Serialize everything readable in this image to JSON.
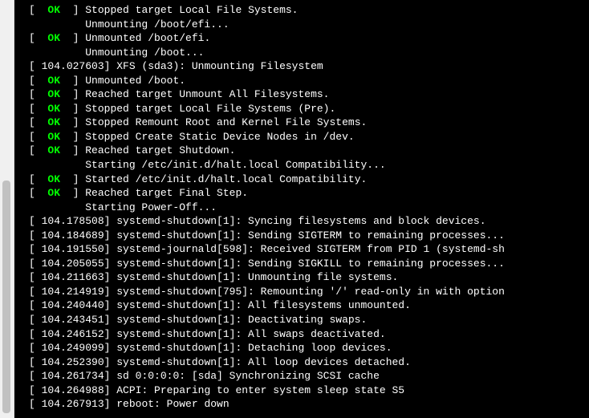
{
  "lines": [
    {
      "type": "ok",
      "text": "Stopped target Local File Systems."
    },
    {
      "type": "plain_indent",
      "text": "Unmounting /boot/efi..."
    },
    {
      "type": "ok",
      "text": "Unmounted /boot/efi."
    },
    {
      "type": "plain_indent",
      "text": "Unmounting /boot..."
    },
    {
      "type": "ts",
      "ts": "104.027603",
      "text": "XFS (sda3): Unmounting Filesystem"
    },
    {
      "type": "ok",
      "text": "Unmounted /boot."
    },
    {
      "type": "ok",
      "text": "Reached target Unmount All Filesystems."
    },
    {
      "type": "ok",
      "text": "Stopped target Local File Systems (Pre)."
    },
    {
      "type": "ok",
      "text": "Stopped Remount Root and Kernel File Systems."
    },
    {
      "type": "ok",
      "text": "Stopped Create Static Device Nodes in /dev."
    },
    {
      "type": "ok",
      "text": "Reached target Shutdown."
    },
    {
      "type": "plain_indent",
      "text": "Starting /etc/init.d/halt.local Compatibility..."
    },
    {
      "type": "ok",
      "text": "Started /etc/init.d/halt.local Compatibility."
    },
    {
      "type": "ok",
      "text": "Reached target Final Step."
    },
    {
      "type": "plain_indent",
      "text": "Starting Power-Off..."
    },
    {
      "type": "ts",
      "ts": "104.178508",
      "text": "systemd-shutdown[1]: Syncing filesystems and block devices."
    },
    {
      "type": "ts",
      "ts": "104.184689",
      "text": "systemd-shutdown[1]: Sending SIGTERM to remaining processes..."
    },
    {
      "type": "ts",
      "ts": "104.191550",
      "text": "systemd-journald[598]: Received SIGTERM from PID 1 (systemd-sh"
    },
    {
      "type": "ts",
      "ts": "104.205055",
      "text": "systemd-shutdown[1]: Sending SIGKILL to remaining processes..."
    },
    {
      "type": "ts",
      "ts": "104.211663",
      "text": "systemd-shutdown[1]: Unmounting file systems."
    },
    {
      "type": "ts",
      "ts": "104.214919",
      "text": "systemd-shutdown[795]: Remounting '/' read-only in with option"
    },
    {
      "type": "ts",
      "ts": "104.240440",
      "text": "systemd-shutdown[1]: All filesystems unmounted."
    },
    {
      "type": "ts",
      "ts": "104.243451",
      "text": "systemd-shutdown[1]: Deactivating swaps."
    },
    {
      "type": "ts",
      "ts": "104.246152",
      "text": "systemd-shutdown[1]: All swaps deactivated."
    },
    {
      "type": "ts",
      "ts": "104.249099",
      "text": "systemd-shutdown[1]: Detaching loop devices."
    },
    {
      "type": "ts",
      "ts": "104.252390",
      "text": "systemd-shutdown[1]: All loop devices detached."
    },
    {
      "type": "ts",
      "ts": "104.261734",
      "text": "sd 0:0:0:0: [sda] Synchronizing SCSI cache"
    },
    {
      "type": "ts",
      "ts": "104.264988",
      "text": "ACPI: Preparing to enter system sleep state S5"
    },
    {
      "type": "ts",
      "ts": "104.267913",
      "text": "reboot: Power down"
    }
  ]
}
